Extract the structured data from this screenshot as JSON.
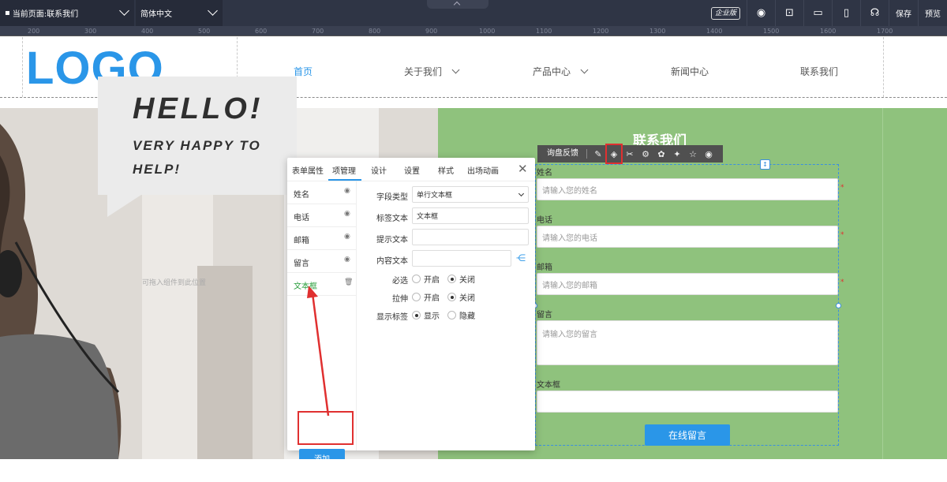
{
  "topbar": {
    "current_page": "当前页面:联系我们",
    "language": "简体中文",
    "edition_badge": "企业版",
    "save_label": "保存",
    "preview_label": "预览",
    "icons": [
      "eye-icon",
      "crop-icon",
      "desktop-icon",
      "mobile-icon",
      "headset-icon"
    ]
  },
  "ruler": {
    "ticks": [
      "200",
      "300",
      "400",
      "500",
      "600",
      "700",
      "800",
      "900",
      "1000",
      "1100",
      "1200",
      "1300",
      "1400",
      "1500",
      "1600",
      "1700"
    ]
  },
  "header": {
    "logo": "LOGO",
    "nav": [
      "首页",
      "关于我们",
      "产品中心",
      "新闻中心",
      "联系我们"
    ]
  },
  "hero": {
    "hello": "HELLO!",
    "tagline": "VERY HAPPY TO HELP!",
    "drag_hint": "可拖入组件到此位置"
  },
  "contact": {
    "title": "联系我们",
    "toolbar_label": "询盘反馈",
    "fields": [
      {
        "label": "姓名",
        "placeholder": "请输入您的姓名"
      },
      {
        "label": "电话",
        "placeholder": "请输入您的电话"
      },
      {
        "label": "邮箱",
        "placeholder": "请输入您的邮箱"
      },
      {
        "label": "留言",
        "placeholder": "请输入您的留言"
      },
      {
        "label": "文本框",
        "placeholder": ""
      }
    ],
    "submit": "在线留言"
  },
  "panel": {
    "tabs": [
      "表单属性",
      "项管理",
      "设计",
      "设置",
      "样式",
      "出场动画"
    ],
    "active_tab": "项管理",
    "items": [
      "姓名",
      "电话",
      "邮箱",
      "留言",
      "文本框"
    ],
    "selected_item": "文本框",
    "add_button": "添加",
    "props": {
      "field_type_label": "字段类型",
      "field_type_value": "单行文本框",
      "tag_text_label": "标签文本",
      "tag_text_value": "文本框",
      "hint_text_label": "提示文本",
      "content_text_label": "内容文本",
      "required_label": "必选",
      "stretch_label": "拉伸",
      "show_label_label": "显示标签",
      "on": "开启",
      "off": "关闭",
      "show": "显示",
      "hide": "隐藏"
    }
  },
  "colors": {
    "accent": "#2a96e8",
    "hero_green": "#8fc27d",
    "topbar": "#2f3545",
    "highlight_red": "#e03030"
  }
}
